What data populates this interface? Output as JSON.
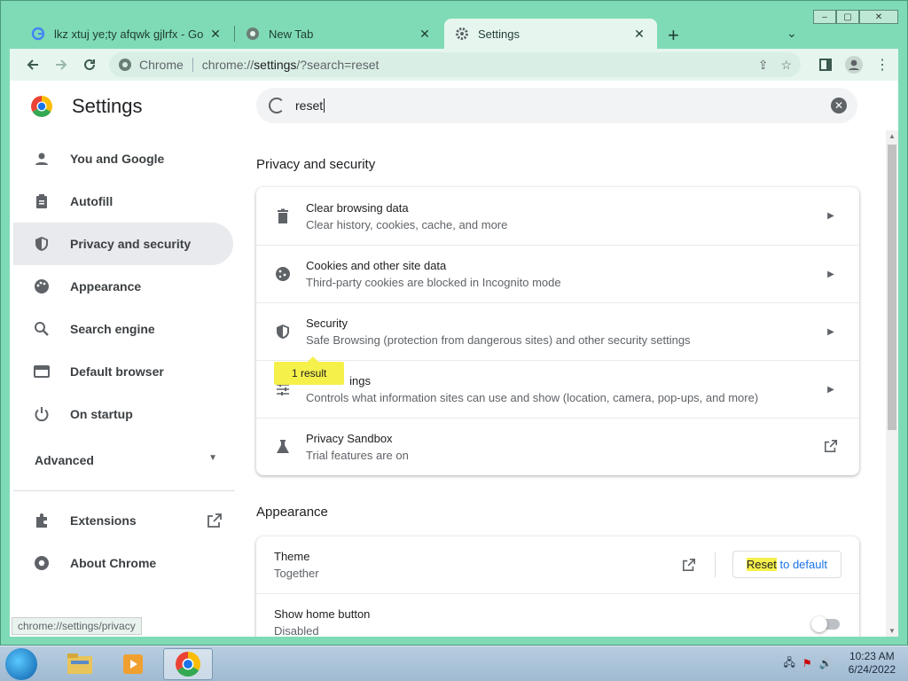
{
  "browser": {
    "tabs": [
      {
        "title": "lkz xtuj ye;ty afqwk gjlrfx - Google",
        "active": false
      },
      {
        "title": "New Tab",
        "active": false
      },
      {
        "title": "Settings",
        "active": true
      }
    ],
    "omnibox": {
      "site_label": "Chrome",
      "url_prefix": "chrome://",
      "url_main": "settings",
      "url_rest": "/?search=reset"
    },
    "status_url": "chrome://settings/privacy"
  },
  "settings": {
    "title": "Settings",
    "search_value": "reset",
    "nav": [
      {
        "label": "You and Google",
        "icon": "person-icon"
      },
      {
        "label": "Autofill",
        "icon": "clipboard-icon"
      },
      {
        "label": "Privacy and security",
        "icon": "shield-icon",
        "selected": true
      },
      {
        "label": "Appearance",
        "icon": "palette-icon"
      },
      {
        "label": "Search engine",
        "icon": "search-icon"
      },
      {
        "label": "Default browser",
        "icon": "browser-icon"
      },
      {
        "label": "On startup",
        "icon": "power-icon"
      }
    ],
    "advanced_label": "Advanced",
    "extensions_label": "Extensions",
    "about_label": "About Chrome",
    "privacy": {
      "section_title": "Privacy and security",
      "rows": [
        {
          "title": "Clear browsing data",
          "subtitle": "Clear history, cookies, cache, and more"
        },
        {
          "title": "Cookies and other site data",
          "subtitle": "Third-party cookies are blocked in Incognito mode"
        },
        {
          "title": "Security",
          "subtitle": "Safe Browsing (protection from dangerous sites) and other security settings"
        },
        {
          "title": "Site Settings",
          "title_visible": "ings",
          "subtitle": "Controls what information sites can use and show (location, camera, pop-ups, and more)"
        },
        {
          "title": "Privacy Sandbox",
          "subtitle": "Trial features are on"
        }
      ],
      "result_bubble": "1 result"
    },
    "appearance": {
      "section_title": "Appearance",
      "theme_title": "Theme",
      "theme_value": "Together",
      "reset_highlight": "Reset",
      "reset_rest": " to default",
      "home_title": "Show home button",
      "home_value": "Disabled",
      "home_enabled": false
    }
  },
  "taskbar": {
    "time": "10:23 AM",
    "date": "6/24/2022"
  }
}
